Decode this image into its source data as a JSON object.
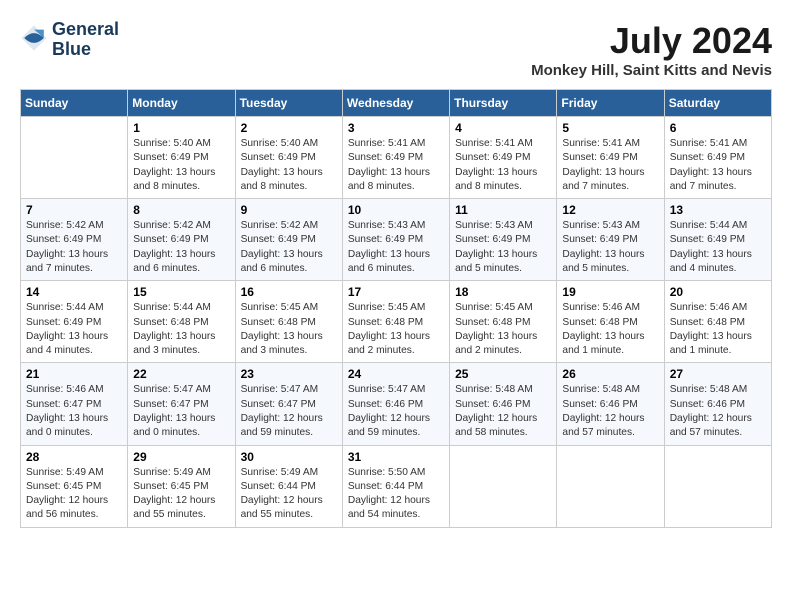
{
  "header": {
    "logo_line1": "General",
    "logo_line2": "Blue",
    "month_year": "July 2024",
    "location": "Monkey Hill, Saint Kitts and Nevis"
  },
  "days_of_week": [
    "Sunday",
    "Monday",
    "Tuesday",
    "Wednesday",
    "Thursday",
    "Friday",
    "Saturday"
  ],
  "weeks": [
    [
      {
        "day": "",
        "info": ""
      },
      {
        "day": "1",
        "info": "Sunrise: 5:40 AM\nSunset: 6:49 PM\nDaylight: 13 hours\nand 8 minutes."
      },
      {
        "day": "2",
        "info": "Sunrise: 5:40 AM\nSunset: 6:49 PM\nDaylight: 13 hours\nand 8 minutes."
      },
      {
        "day": "3",
        "info": "Sunrise: 5:41 AM\nSunset: 6:49 PM\nDaylight: 13 hours\nand 8 minutes."
      },
      {
        "day": "4",
        "info": "Sunrise: 5:41 AM\nSunset: 6:49 PM\nDaylight: 13 hours\nand 8 minutes."
      },
      {
        "day": "5",
        "info": "Sunrise: 5:41 AM\nSunset: 6:49 PM\nDaylight: 13 hours\nand 7 minutes."
      },
      {
        "day": "6",
        "info": "Sunrise: 5:41 AM\nSunset: 6:49 PM\nDaylight: 13 hours\nand 7 minutes."
      }
    ],
    [
      {
        "day": "7",
        "info": "Sunrise: 5:42 AM\nSunset: 6:49 PM\nDaylight: 13 hours\nand 7 minutes."
      },
      {
        "day": "8",
        "info": "Sunrise: 5:42 AM\nSunset: 6:49 PM\nDaylight: 13 hours\nand 6 minutes."
      },
      {
        "day": "9",
        "info": "Sunrise: 5:42 AM\nSunset: 6:49 PM\nDaylight: 13 hours\nand 6 minutes."
      },
      {
        "day": "10",
        "info": "Sunrise: 5:43 AM\nSunset: 6:49 PM\nDaylight: 13 hours\nand 6 minutes."
      },
      {
        "day": "11",
        "info": "Sunrise: 5:43 AM\nSunset: 6:49 PM\nDaylight: 13 hours\nand 5 minutes."
      },
      {
        "day": "12",
        "info": "Sunrise: 5:43 AM\nSunset: 6:49 PM\nDaylight: 13 hours\nand 5 minutes."
      },
      {
        "day": "13",
        "info": "Sunrise: 5:44 AM\nSunset: 6:49 PM\nDaylight: 13 hours\nand 4 minutes."
      }
    ],
    [
      {
        "day": "14",
        "info": "Sunrise: 5:44 AM\nSunset: 6:49 PM\nDaylight: 13 hours\nand 4 minutes."
      },
      {
        "day": "15",
        "info": "Sunrise: 5:44 AM\nSunset: 6:48 PM\nDaylight: 13 hours\nand 3 minutes."
      },
      {
        "day": "16",
        "info": "Sunrise: 5:45 AM\nSunset: 6:48 PM\nDaylight: 13 hours\nand 3 minutes."
      },
      {
        "day": "17",
        "info": "Sunrise: 5:45 AM\nSunset: 6:48 PM\nDaylight: 13 hours\nand 2 minutes."
      },
      {
        "day": "18",
        "info": "Sunrise: 5:45 AM\nSunset: 6:48 PM\nDaylight: 13 hours\nand 2 minutes."
      },
      {
        "day": "19",
        "info": "Sunrise: 5:46 AM\nSunset: 6:48 PM\nDaylight: 13 hours\nand 1 minute."
      },
      {
        "day": "20",
        "info": "Sunrise: 5:46 AM\nSunset: 6:48 PM\nDaylight: 13 hours\nand 1 minute."
      }
    ],
    [
      {
        "day": "21",
        "info": "Sunrise: 5:46 AM\nSunset: 6:47 PM\nDaylight: 13 hours\nand 0 minutes."
      },
      {
        "day": "22",
        "info": "Sunrise: 5:47 AM\nSunset: 6:47 PM\nDaylight: 13 hours\nand 0 minutes."
      },
      {
        "day": "23",
        "info": "Sunrise: 5:47 AM\nSunset: 6:47 PM\nDaylight: 12 hours\nand 59 minutes."
      },
      {
        "day": "24",
        "info": "Sunrise: 5:47 AM\nSunset: 6:46 PM\nDaylight: 12 hours\nand 59 minutes."
      },
      {
        "day": "25",
        "info": "Sunrise: 5:48 AM\nSunset: 6:46 PM\nDaylight: 12 hours\nand 58 minutes."
      },
      {
        "day": "26",
        "info": "Sunrise: 5:48 AM\nSunset: 6:46 PM\nDaylight: 12 hours\nand 57 minutes."
      },
      {
        "day": "27",
        "info": "Sunrise: 5:48 AM\nSunset: 6:46 PM\nDaylight: 12 hours\nand 57 minutes."
      }
    ],
    [
      {
        "day": "28",
        "info": "Sunrise: 5:49 AM\nSunset: 6:45 PM\nDaylight: 12 hours\nand 56 minutes."
      },
      {
        "day": "29",
        "info": "Sunrise: 5:49 AM\nSunset: 6:45 PM\nDaylight: 12 hours\nand 55 minutes."
      },
      {
        "day": "30",
        "info": "Sunrise: 5:49 AM\nSunset: 6:44 PM\nDaylight: 12 hours\nand 55 minutes."
      },
      {
        "day": "31",
        "info": "Sunrise: 5:50 AM\nSunset: 6:44 PM\nDaylight: 12 hours\nand 54 minutes."
      },
      {
        "day": "",
        "info": ""
      },
      {
        "day": "",
        "info": ""
      },
      {
        "day": "",
        "info": ""
      }
    ]
  ]
}
